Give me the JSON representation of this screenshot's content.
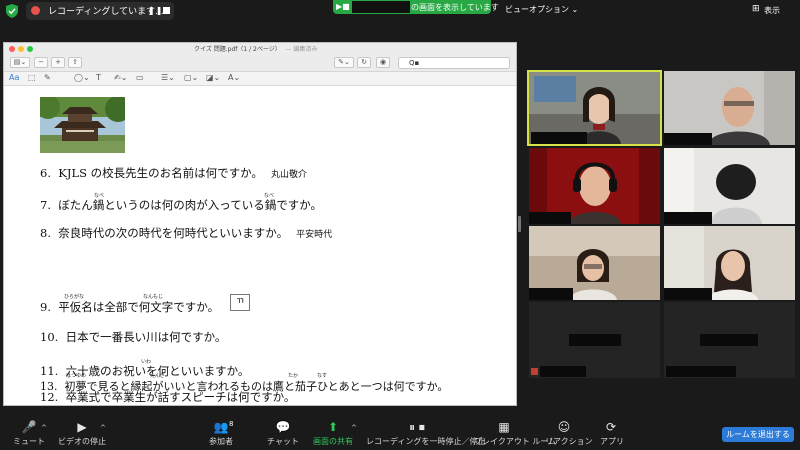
{
  "top_bar": {
    "recording_label": "レコーディングしています...",
    "recording_pause": "❚❚",
    "sharing_suffix": "の画面を表示しています",
    "view_options": "ビューオプション ⌄",
    "view_button": "表示"
  },
  "pdf_window": {
    "title": "クイズ 問題.pdf（1 / 2ページ）",
    "title_note": "— 編集済み",
    "search_value": "Q▪"
  },
  "questions": [
    {
      "num": "6.",
      "text": "KJLS の校長先生のお名前は何ですか。",
      "answer": "丸山敬介"
    },
    {
      "num": "7.",
      "text": "ぼたん鍋というのは何の肉が入っている鍋ですか。",
      "answer": ""
    },
    {
      "num": "8.",
      "text": "奈良時代の次の時代を何時代といいますか。",
      "answer": "平安時代"
    },
    {
      "num": "9.",
      "text": "平仮名は全部で何文字ですか。",
      "answer": "",
      "box_answer": "ㄲ"
    },
    {
      "num": "10.",
      "text": "日本で一番長い川は何ですか。",
      "answer": ""
    },
    {
      "num": "11.",
      "text": "六十歳のお祝いを何といいますか。",
      "answer": ""
    },
    {
      "num": "12.",
      "text": "卒業式で卒業生が話すスピーチは何ですか。",
      "answer": ""
    },
    {
      "num": "13.",
      "text": "初夢で見ると縁起がいいと言われるものは鷹と茄子ひとあと一つは何ですか。",
      "answer": ""
    }
  ],
  "ruby": {
    "q7a": "なべ",
    "q7b": "なべ",
    "q9a": "ひらがな",
    "q9b": "なんもじ",
    "q11": "いわ",
    "q13a": "はつゆめ",
    "q13b": "えんぎ",
    "q13c": "たか",
    "q13d": "なす"
  },
  "toolbar": {
    "mute": "ミュート",
    "video_stop": "ビデオの停止",
    "participants": "参加者",
    "participants_count": "8",
    "chat": "チャット",
    "share": "画面の共有",
    "recording": "レコーディングを一時停止／停止",
    "breakout": "ブレイクアウト ルーム",
    "reactions": "リアクション",
    "apps": "アプリ",
    "leave": "ルームを退出する"
  },
  "icons": {
    "mic": "mic-icon",
    "video": "video-icon",
    "participants": "participants-icon",
    "chat": "chat-icon",
    "share": "share-screen-icon",
    "recording": "record-pause-icon",
    "breakout": "breakout-icon",
    "reactions": "reaction-icon",
    "apps": "apps-icon"
  },
  "colors": {
    "share_green": "#27a844",
    "leave_blue": "#2d7bd8",
    "record_red": "#e5534b",
    "active_speaker": "#d6e24a"
  }
}
